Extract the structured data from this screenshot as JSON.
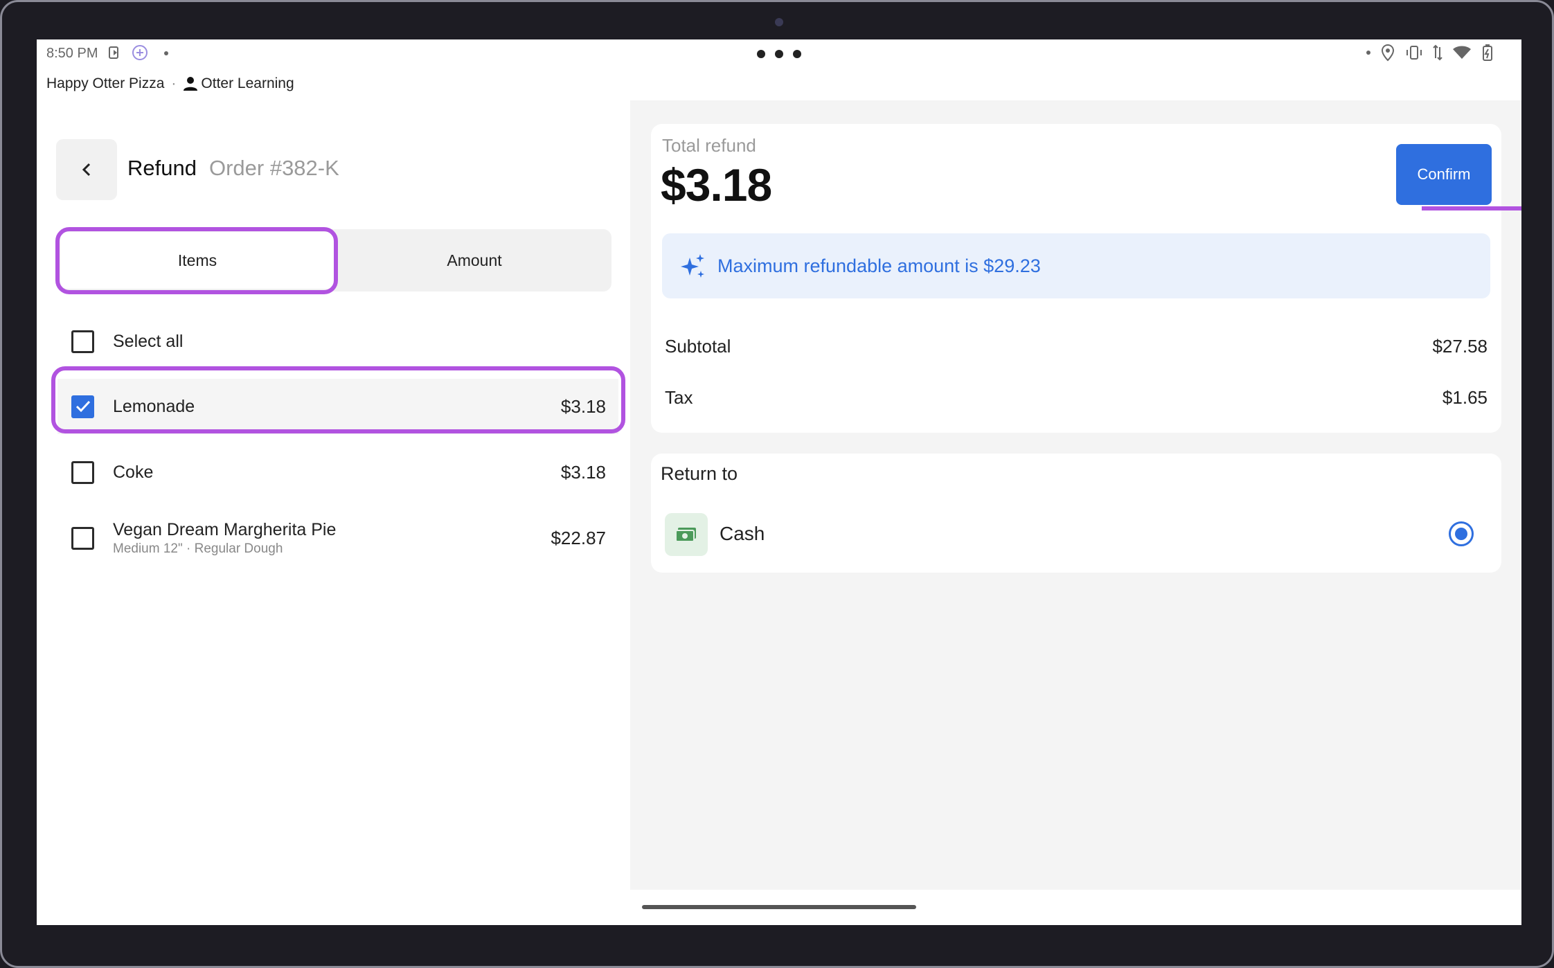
{
  "status_bar": {
    "time": "8:50 PM"
  },
  "header": {
    "store_name": "Happy Otter Pizza",
    "separator": "·",
    "user_name": "Otter Learning"
  },
  "refund": {
    "title": "Refund",
    "order": "Order #382-K",
    "tabs": [
      {
        "label": "Items",
        "active": true
      },
      {
        "label": "Amount",
        "active": false
      }
    ],
    "select_all_label": "Select all",
    "items": [
      {
        "name": "Lemonade",
        "modifiers": "",
        "price": "$3.18",
        "checked": true
      },
      {
        "name": "Coke",
        "modifiers": "",
        "price": "$3.18",
        "checked": false
      },
      {
        "name": "Vegan Dream Margherita Pie",
        "modifiers": "Medium 12\" · Regular Dough",
        "price": "$22.87",
        "checked": false
      }
    ]
  },
  "summary": {
    "total_label": "Total refund",
    "total_amount": "$3.18",
    "confirm_label": "Confirm",
    "info_text": "Maximum refundable amount is $29.23",
    "subtotal_label": "Subtotal",
    "subtotal_value": "$27.58",
    "tax_label": "Tax",
    "tax_value": "$1.65"
  },
  "return_to": {
    "label": "Return to",
    "method": "Cash",
    "selected": true
  },
  "colors": {
    "accent": "#2f6fdf",
    "highlight": "#b153e0",
    "info_bg": "#eaf1fc"
  }
}
